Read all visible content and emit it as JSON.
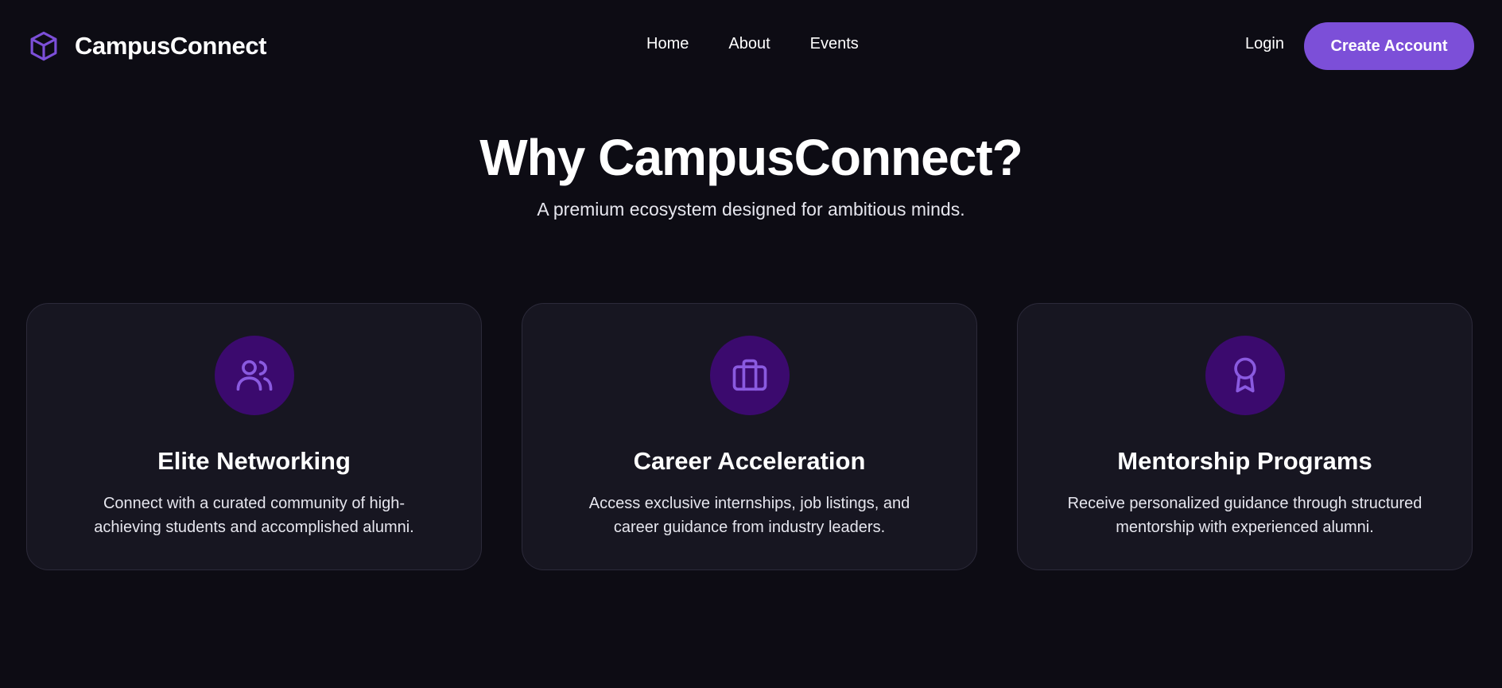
{
  "brand": {
    "name": "CampusConnect",
    "icon": "cube-icon",
    "accent": "#7c4fd8"
  },
  "nav": {
    "links": [
      "Home",
      "About",
      "Events"
    ],
    "login": "Login",
    "cta": "Create Account"
  },
  "hero": {
    "title": "Why CampusConnect?",
    "subtitle": "A premium ecosystem designed for ambitious minds."
  },
  "features": [
    {
      "icon": "users-icon",
      "title": "Elite Networking",
      "description": "Connect with a curated community of high-achieving students and accomplished alumni."
    },
    {
      "icon": "briefcase-icon",
      "title": "Career Acceleration",
      "description": "Access exclusive internships, job listings, and career guidance from industry leaders."
    },
    {
      "icon": "award-icon",
      "title": "Mentorship Programs",
      "description": "Receive personalized guidance through structured mentorship with experienced alumni."
    }
  ],
  "colors": {
    "background": "#0d0c14",
    "card_background": "#171621",
    "icon_circle": "#3b0a6e",
    "accent": "#7c4fd8"
  }
}
